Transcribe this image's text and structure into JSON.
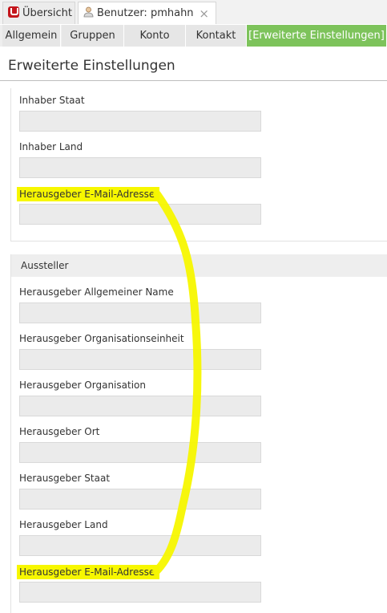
{
  "doc_tabs": {
    "overview_label": "Übersicht",
    "user_label": "Benutzer: pmhahn",
    "close_symbol": "×"
  },
  "nav_tabs": {
    "items": [
      {
        "label": "Allgemein"
      },
      {
        "label": "Gruppen"
      },
      {
        "label": "Konto"
      },
      {
        "label": "Kontakt"
      },
      {
        "label": "[Erweiterte Einstellungen]"
      }
    ],
    "active_index": 4
  },
  "page": {
    "title": "Erweiterte Einstellungen"
  },
  "owner_section": {
    "fields": [
      {
        "label": "Inhaber Staat",
        "value": ""
      },
      {
        "label": "Inhaber Land",
        "value": ""
      },
      {
        "label": "Herausgeber E-Mail-Adresse",
        "value": ""
      }
    ]
  },
  "issuer_section": {
    "header": "Aussteller",
    "fields": [
      {
        "label": "Herausgeber Allgemeiner Name",
        "value": ""
      },
      {
        "label": "Herausgeber Organisationseinheit",
        "value": ""
      },
      {
        "label": "Herausgeber Organisation",
        "value": ""
      },
      {
        "label": "Herausgeber Ort",
        "value": ""
      },
      {
        "label": "Herausgeber Staat",
        "value": ""
      },
      {
        "label": "Herausgeber Land",
        "value": ""
      },
      {
        "label": "Herausgeber E-Mail-Adresse",
        "value": ""
      }
    ]
  },
  "colors": {
    "active_tab": "#7dc35b",
    "highlight": "#f7f700",
    "logo": "#c4161c"
  }
}
